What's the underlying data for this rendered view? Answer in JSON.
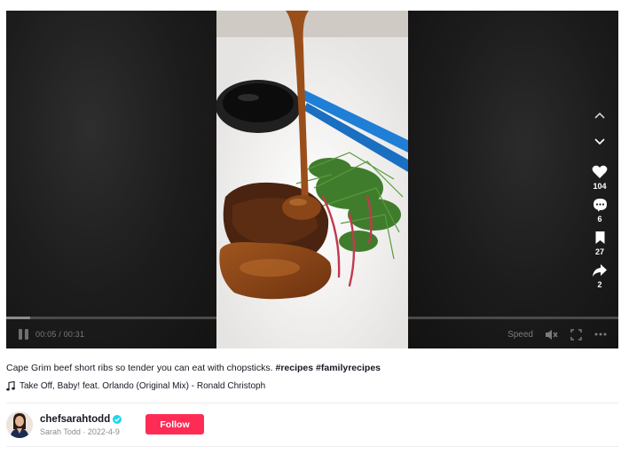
{
  "player": {
    "current_time": "00:05",
    "duration": "00:31",
    "time_separator": " / ",
    "progress": 0.16,
    "speed_label": "Speed"
  },
  "actions": {
    "likes": "104",
    "comments": "6",
    "bookmarks": "27",
    "shares": "2"
  },
  "post": {
    "caption_text": "Cape Grim beef short ribs so tender you can eat with chopsticks. ",
    "hashtags": [
      "#recipes",
      "#familyrecipes"
    ],
    "music": "Take Off, Baby! feat. Orlando (Original Mix) - Ronald Christoph"
  },
  "author": {
    "username": "chefsarahtodd",
    "verified": true,
    "display_name": "Sarah Todd",
    "date": "2022-4-9",
    "meta_separator": " · ",
    "follow_label": "Follow"
  },
  "colors": {
    "accent": "#fe2c55",
    "verified_badge": "#20d5ec",
    "chopstick_blue": "#1f7fd6",
    "sauce_brown": "#8a4618"
  },
  "icons": [
    "pause-icon",
    "mute-icon",
    "fullscreen-icon",
    "more-icon",
    "chevron-up-icon",
    "chevron-down-icon",
    "heart-icon",
    "comment-icon",
    "bookmark-icon",
    "share-icon",
    "music-note-icon",
    "verified-icon"
  ]
}
